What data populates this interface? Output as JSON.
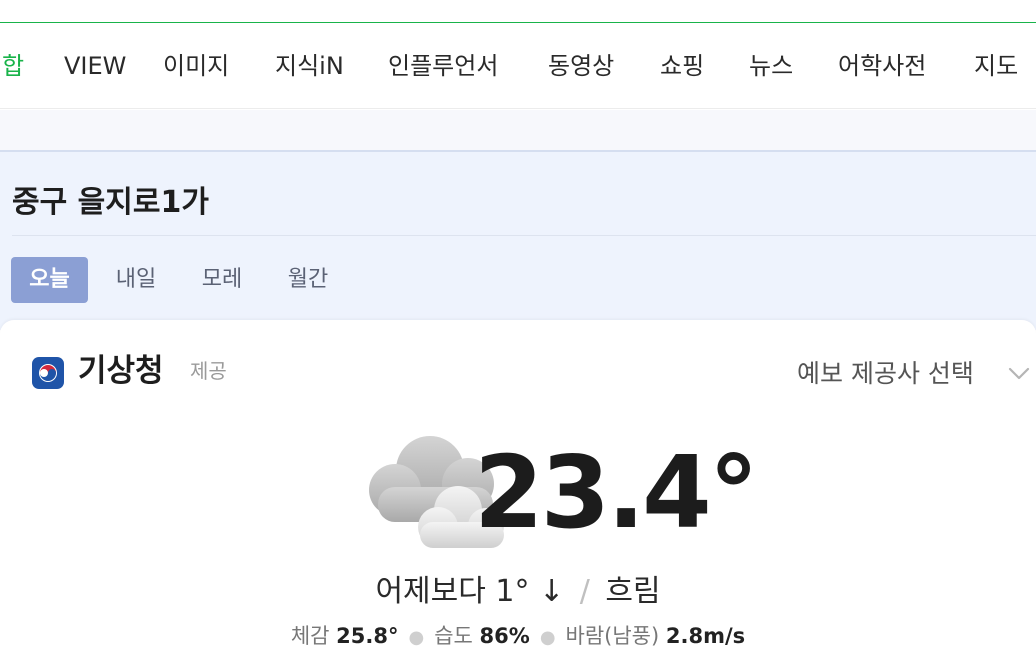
{
  "nav": {
    "items": [
      {
        "label": "합",
        "active": true
      },
      {
        "label": "VIEW"
      },
      {
        "label": "이미지"
      },
      {
        "label": "지식iN"
      },
      {
        "label": "인플루언서"
      },
      {
        "label": "동영상"
      },
      {
        "label": "쇼핑"
      },
      {
        "label": "뉴스"
      },
      {
        "label": "어학사전"
      },
      {
        "label": "지도"
      }
    ]
  },
  "location": "중구 을지로1가",
  "day_tabs": [
    {
      "label": "오늘",
      "active": true
    },
    {
      "label": "내일"
    },
    {
      "label": "모레"
    },
    {
      "label": "월간"
    }
  ],
  "provider": {
    "name": "기상청",
    "provide_label": "제공",
    "select_label": "예보 제공사 선택",
    "logo_icon": "kma-logo-icon"
  },
  "weather": {
    "temperature": "23.4°",
    "icon": "cloudy-icon",
    "compare": "어제보다 1° ↓",
    "separator": "/",
    "condition": "흐림",
    "feels_like_label": "체감",
    "feels_like_value": "25.8°",
    "humidity_label": "습도",
    "humidity_value": "86%",
    "wind_label": "바람(남풍)",
    "wind_value": "2.8m/s"
  },
  "colors": {
    "accent_green": "#19b34a",
    "active_tab_bg": "#8b9fd4",
    "section_bg": "#eef3fd"
  }
}
